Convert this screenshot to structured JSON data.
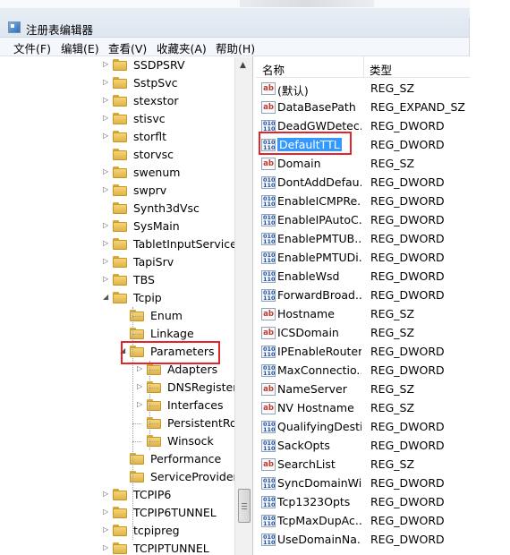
{
  "window": {
    "title": "注册表编辑器"
  },
  "menu": [
    "文件(F)",
    "编辑(E)",
    "查看(V)",
    "收藏夹(A)",
    "帮助(H)"
  ],
  "tree": [
    {
      "label": "SSDPSRV",
      "level": 0,
      "arrow": "▷"
    },
    {
      "label": "SstpSvc",
      "level": 0,
      "arrow": "▷"
    },
    {
      "label": "stexstor",
      "level": 0,
      "arrow": "▷"
    },
    {
      "label": "stisvc",
      "level": 0,
      "arrow": "▷"
    },
    {
      "label": "storflt",
      "level": 0,
      "arrow": "▷"
    },
    {
      "label": "storvsc",
      "level": 0,
      "arrow": ""
    },
    {
      "label": "swenum",
      "level": 0,
      "arrow": "▷"
    },
    {
      "label": "swprv",
      "level": 0,
      "arrow": "▷"
    },
    {
      "label": "Synth3dVsc",
      "level": 0,
      "arrow": ""
    },
    {
      "label": "SysMain",
      "level": 0,
      "arrow": "▷"
    },
    {
      "label": "TabletInputService",
      "level": 0,
      "arrow": "▷"
    },
    {
      "label": "TapiSrv",
      "level": 0,
      "arrow": "▷"
    },
    {
      "label": "TBS",
      "level": 0,
      "arrow": "▷"
    },
    {
      "label": "Tcpip",
      "level": 0,
      "arrow": "◢"
    },
    {
      "label": "Enum",
      "level": 1,
      "arrow": ""
    },
    {
      "label": "Linkage",
      "level": 1,
      "arrow": ""
    },
    {
      "label": "Parameters",
      "level": 1,
      "arrow": "◢"
    },
    {
      "label": "Adapters",
      "level": 2,
      "arrow": "▷"
    },
    {
      "label": "DNSRegistere",
      "level": 2,
      "arrow": "▷"
    },
    {
      "label": "Interfaces",
      "level": 2,
      "arrow": "▷"
    },
    {
      "label": "PersistentRou",
      "level": 2,
      "arrow": ""
    },
    {
      "label": "Winsock",
      "level": 2,
      "arrow": ""
    },
    {
      "label": "Performance",
      "level": 1,
      "arrow": ""
    },
    {
      "label": "ServiceProvider",
      "level": 1,
      "arrow": ""
    },
    {
      "label": "TCPIP6",
      "level": 0,
      "arrow": "▷"
    },
    {
      "label": "TCPIP6TUNNEL",
      "level": 0,
      "arrow": "▷"
    },
    {
      "label": "tcpipreg",
      "level": 0,
      "arrow": "▷"
    },
    {
      "label": "TCPIPTUNNEL",
      "level": 0,
      "arrow": "▷"
    }
  ],
  "list_header": {
    "name": "名称",
    "type": "类型"
  },
  "values": [
    {
      "name": "(默认)",
      "type": "REG_SZ",
      "icon": "string-value-icon"
    },
    {
      "name": "DataBasePath",
      "type": "REG_EXPAND_SZ",
      "icon": "string-value-icon"
    },
    {
      "name": "DeadGWDetec...",
      "type": "REG_DWORD",
      "icon": "dword-value-icon"
    },
    {
      "name": "DefaultTTL",
      "type": "REG_DWORD",
      "icon": "dword-value-icon"
    },
    {
      "name": "Domain",
      "type": "REG_SZ",
      "icon": "string-value-icon"
    },
    {
      "name": "DontAddDefau...",
      "type": "REG_DWORD",
      "icon": "dword-value-icon"
    },
    {
      "name": "EnableICMPRe...",
      "type": "REG_DWORD",
      "icon": "dword-value-icon"
    },
    {
      "name": "EnableIPAutoC...",
      "type": "REG_DWORD",
      "icon": "dword-value-icon"
    },
    {
      "name": "EnablePMTUB...",
      "type": "REG_DWORD",
      "icon": "dword-value-icon"
    },
    {
      "name": "EnablePMTUDi...",
      "type": "REG_DWORD",
      "icon": "dword-value-icon"
    },
    {
      "name": "EnableWsd",
      "type": "REG_DWORD",
      "icon": "dword-value-icon"
    },
    {
      "name": "ForwardBroad...",
      "type": "REG_DWORD",
      "icon": "dword-value-icon"
    },
    {
      "name": "Hostname",
      "type": "REG_SZ",
      "icon": "string-value-icon"
    },
    {
      "name": "ICSDomain",
      "type": "REG_SZ",
      "icon": "string-value-icon"
    },
    {
      "name": "IPEnableRouter",
      "type": "REG_DWORD",
      "icon": "dword-value-icon"
    },
    {
      "name": "MaxConnectio...",
      "type": "REG_DWORD",
      "icon": "dword-value-icon"
    },
    {
      "name": "NameServer",
      "type": "REG_SZ",
      "icon": "string-value-icon"
    },
    {
      "name": "NV Hostname",
      "type": "REG_SZ",
      "icon": "string-value-icon"
    },
    {
      "name": "QualifyingDesti...",
      "type": "REG_DWORD",
      "icon": "dword-value-icon"
    },
    {
      "name": "SackOpts",
      "type": "REG_DWORD",
      "icon": "dword-value-icon"
    },
    {
      "name": "SearchList",
      "type": "REG_SZ",
      "icon": "string-value-icon"
    },
    {
      "name": "SyncDomainWi...",
      "type": "REG_DWORD",
      "icon": "dword-value-icon"
    },
    {
      "name": "Tcp1323Opts",
      "type": "REG_DWORD",
      "icon": "dword-value-icon"
    },
    {
      "name": "TcpMaxDupAc...",
      "type": "REG_DWORD",
      "icon": "dword-value-icon"
    },
    {
      "name": "UseDomainNa...",
      "type": "REG_DWORD",
      "icon": "dword-value-icon"
    }
  ],
  "selected_value": "DefaultTTL",
  "highlight_color": "#e3242b",
  "selection_color": "#3399ff"
}
